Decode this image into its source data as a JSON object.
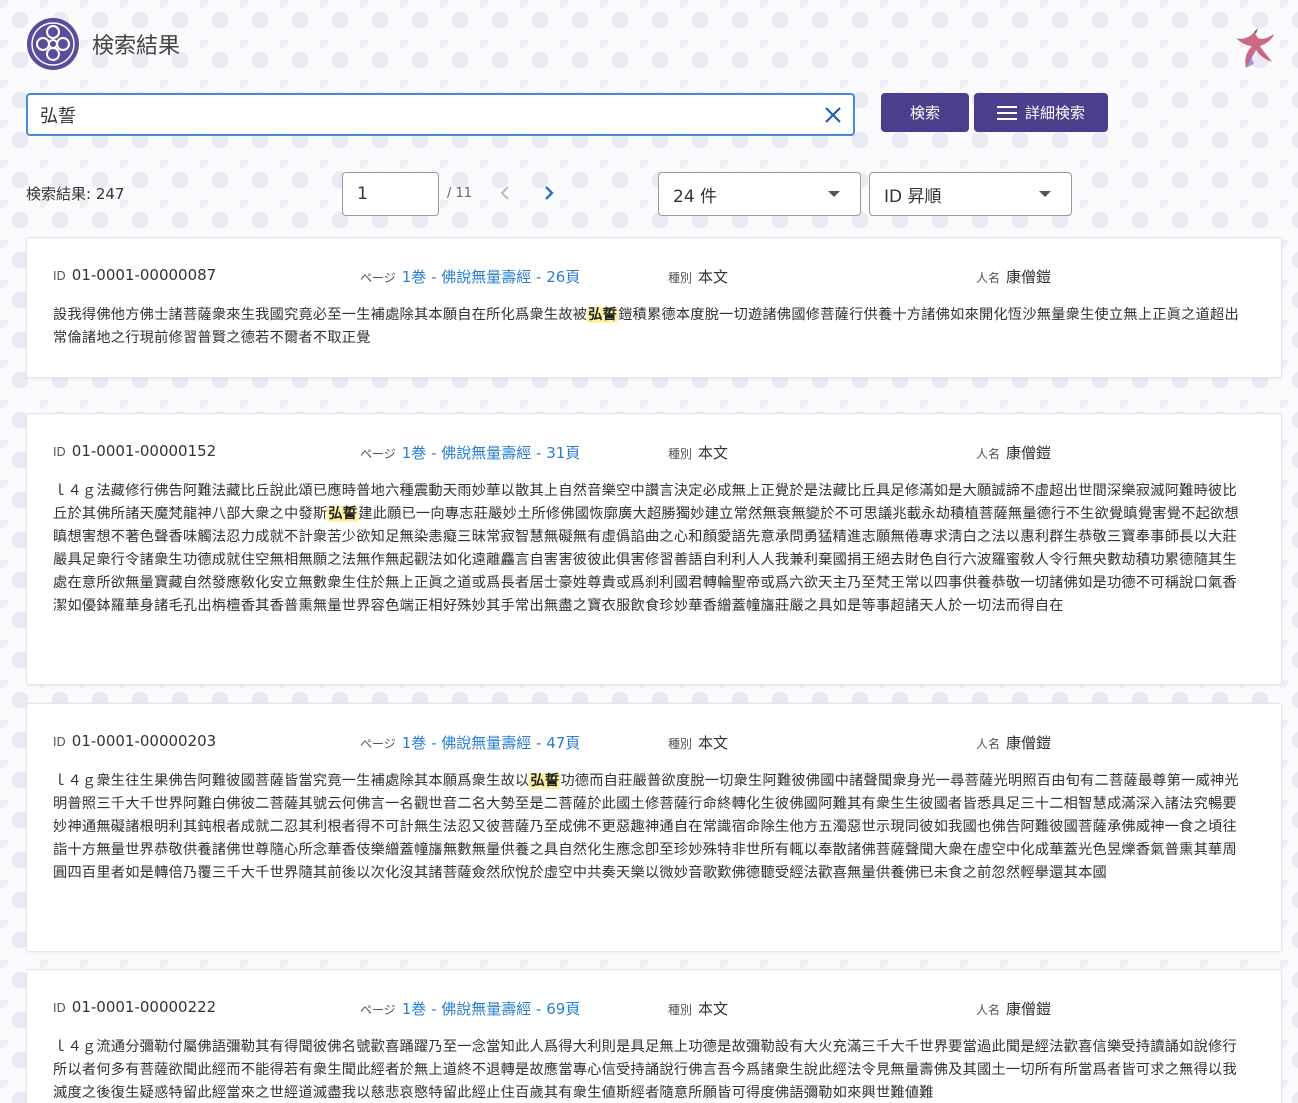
{
  "header": {
    "title": "検索結果"
  },
  "search": {
    "query": "弘誓",
    "search_label": "検索",
    "advanced_label": "詳細検索"
  },
  "results": {
    "count_label": "検索結果: 247",
    "page": "1",
    "page_total": "/ 11",
    "per_page": "24 件",
    "sort": "ID 昇順"
  },
  "labels": {
    "id": "ID",
    "page": "ページ",
    "kind": "種別",
    "person": "人名"
  },
  "cards": [
    {
      "id": "01-0001-00000087",
      "page": "1巻 - 佛說無量壽經 - 26頁",
      "kind": "本文",
      "person": "康僧鎧",
      "pre": "設我得佛他方佛士諸菩薩衆來生我國究竟必至一生補處除其本願自在所化爲衆生故被",
      "hit": "弘誓",
      "post": "鎧積累德本度脫一切遊諸佛國修菩薩行供養十方諸佛如來開化恆沙無量衆生使立無上正眞之道超出常倫諸地之行現前修習普賢之德若不爾者不取正覺"
    },
    {
      "id": "01-0001-00000152",
      "page": "1巻 - 佛說無量壽經 - 31頁",
      "kind": "本文",
      "person": "康僧鎧",
      "pre": "ｌ４ｇ法藏修行佛告阿難法藏比丘說此頌已應時普地六種震動天雨妙華以散其上自然音樂空中讚言決定必成無上正覺於是法藏比丘具足修滿如是大願誠諦不虛超出世間深樂寂滅阿難時彼比丘於其佛所諸天魔梵龍神八部大衆之中發斯",
      "hit": "弘誓",
      "post": "建此願已一向專志莊嚴妙土所修佛國恢廓廣大超勝獨妙建立常然無衰無變於不可思議兆載永劫積植菩薩無量德行不生欲覺瞋覺害覺不起欲想瞋想害想不著色聲香味觸法忍力成就不計衆苦少欲知足無染恚癡三昧常寂智慧無礙無有虛僞諂曲之心和顏愛語先意承問勇猛精進志願無倦專求淸白之法以惠利群生恭敬三寶奉事師長以大莊嚴具足衆行令諸衆生功德成就住空無相無願之法無作無起觀法如化遠離麤言自害害彼彼此俱害修習善語自利利人人我兼利棄國捐王絕去財色自行六波羅蜜敎人令行無央數劫積功累德隨其生處在意所欲無量寶藏自然發應敎化安立無數衆生住於無上正眞之道或爲長者居士豪姓尊貴或爲刹利國君轉輪聖帝或爲六欲天主乃至梵王常以四事供養恭敬一切諸佛如是功德不可稱說口氣香潔如優鉢羅華身諸毛孔出栴檀香其香普熏無量世界容色端正相好殊妙其手常出無盡之寶衣服飮食珍妙華香繒蓋幢旛莊嚴之具如是等事超諸天人於一切法而得自在"
    },
    {
      "id": "01-0001-00000203",
      "page": "1巻 - 佛說無量壽經 - 47頁",
      "kind": "本文",
      "person": "康僧鎧",
      "pre": "ｌ４ｇ衆生往生果佛告阿難彼國菩薩皆當究竟一生補處除其本願爲衆生故以",
      "hit": "弘誓",
      "post": "功德而自莊嚴普欲度脫一切衆生阿難彼佛國中諸聲聞衆身光一尋菩薩光明照百由旬有二菩薩最尊第一威神光明普照三千大千世界阿難白佛彼二菩薩其號云何佛言一名觀世音二名大勢至是二菩薩於此國土修菩薩行命終轉化生彼佛國阿難其有衆生生彼國者皆悉具足三十二相智慧成滿深入諸法究暢要妙神通無礙諸根明利其鈍根者成就二忍其利根者得不可計無生法忍又彼菩薩乃至成佛不更惡趣神通自在常識宿命除生他方五濁惡世示現同彼如我國也佛告阿難彼國菩薩承佛威神一食之頃往詣十方無量世界恭敬供養諸佛世尊隨心所念華香伎樂繒蓋幢旛無數無量供養之具自然化生應念卽至珍妙殊特非世所有輒以奉散諸佛菩薩聲聞大衆在虛空中化成華蓋光色昱爍香氣普熏其華周圓四百里者如是轉倍乃覆三千大千世界隨其前後以次化沒其諸菩薩僉然欣悅於虛空中共奏天樂以微妙音歌歎佛德聽受經法歡喜無量供養佛已未食之前忽然輕擧還其本國"
    },
    {
      "id": "01-0001-00000222",
      "page": "1巻 - 佛說無量壽經 - 69頁",
      "kind": "本文",
      "person": "康僧鎧",
      "pre": "ｌ４ｇ流通分彌勒付屬佛語彌勒其有得聞彼佛名號歡喜踊躍乃至一念當知此人爲得大利則是具足無上功德是故彌勒設有大火充滿三千大千世界要當過此聞是經法歡喜信樂受持讀誦如說修行所以者何多有菩薩欲聞此經而不能得若有衆生聞此經者於無上道終不退轉是故應當專心信受持誦說行佛言吾今爲諸衆生說此經法令見無量壽佛及其國土一切所有所當爲者皆可求之無得以我滅度之後復生疑惑特留此經當來之世經道滅盡我以慈悲哀愍特留此經止住百歲其有衆生値斯經者隨意所願皆可得度佛語彌勒如來興世難値難",
      "hit": "",
      "post": ""
    }
  ]
}
